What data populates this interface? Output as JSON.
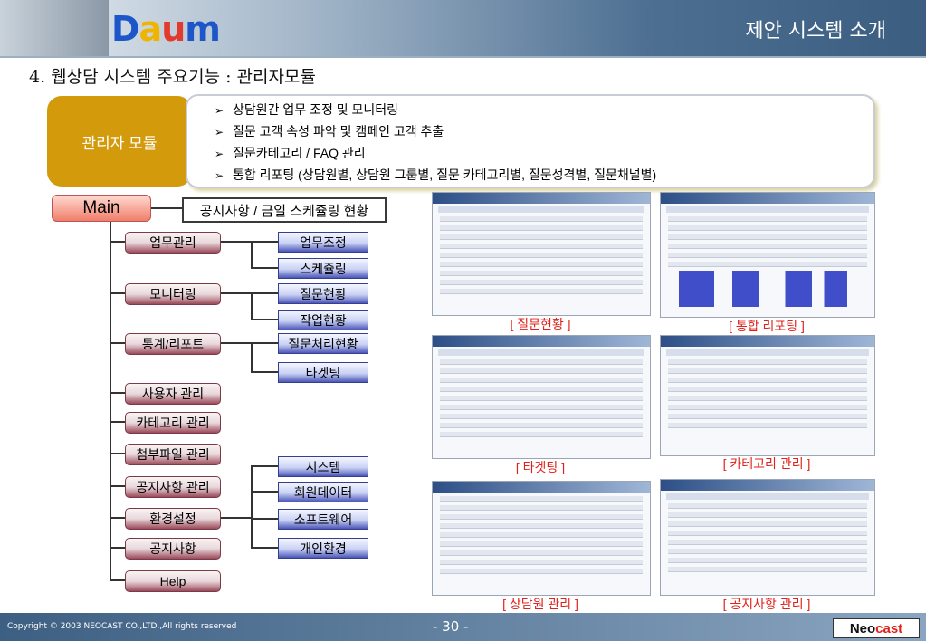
{
  "header": {
    "logo_letters": [
      "D",
      "a",
      "u",
      "m"
    ],
    "title": "제안 시스템 소개"
  },
  "subtitle": "4. 웹상담 시스템 주요기능 : 관리자모듈",
  "module": {
    "label": "관리자 모듈",
    "features": [
      "상담원간 업무 조정 및 모니터링",
      "질문 고객 속성 파악 및 캠페인 고객 추출",
      "질문카테고리 / FAQ 관리",
      "통합 리포팅 (상담원별, 상담원 그룹별, 질문 카테고리별, 질문성격별, 질문채널별)"
    ]
  },
  "tree": {
    "main": "Main",
    "notice": "공지사항 / 금일 스케쥴링 현황",
    "categories": [
      "업무관리",
      "모니터링",
      "통계/리포트",
      "사용자 관리",
      "카테고리 관리",
      "첨부파일 관리",
      "공지사항 관리",
      "환경설정",
      "공지사항",
      "Help"
    ],
    "subs": [
      "업무조정",
      "스케쥴링",
      "질문현황",
      "작업현황",
      "질문처리현황",
      "타겟팅",
      "시스템",
      "회원데이터",
      "소프트웨어",
      "개인환경"
    ]
  },
  "screens": [
    {
      "caption": "[ 질문현황 ]"
    },
    {
      "caption": "[ 통합 리포팅 ]"
    },
    {
      "caption": "[ 타겟팅 ]"
    },
    {
      "caption": "[ 카테고리 관리 ]"
    },
    {
      "caption": "[ 상담원 관리 ]"
    },
    {
      "caption": "[ 공지사항 관리 ]"
    }
  ],
  "footer": {
    "copyright": "Copyright © 2003 NEOCAST CO.,LTD.,All rights reserved",
    "page": "- 30 -",
    "brand_neo": "Neo",
    "brand_cast": "cast"
  },
  "colors": {
    "accent_orange": "#d39a0c",
    "caption_red": "#e0201a",
    "footer_blue": "#3d5f82"
  }
}
